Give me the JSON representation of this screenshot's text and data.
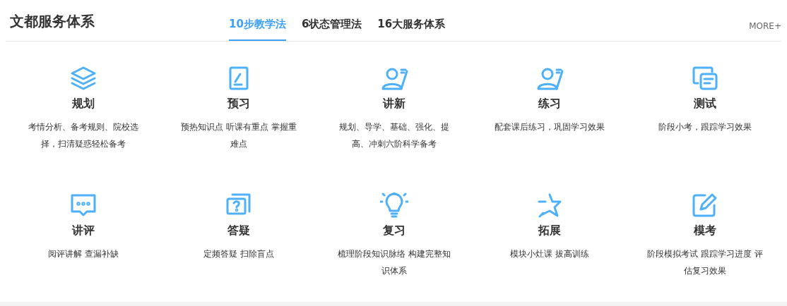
{
  "header": {
    "title": "文都服务体系",
    "more": "MORE+"
  },
  "tabs": [
    {
      "label": "10步教学法",
      "selected": true
    },
    {
      "label": "6状态管理法",
      "selected": false
    },
    {
      "label": "16大服务体系",
      "selected": false
    }
  ],
  "steps": [
    {
      "title": "规划",
      "description": "考情分析、备考规则、院校选择，扫清疑惑轻松备考"
    },
    {
      "title": "预习",
      "description": "预热知识点 听课有重点 掌握重难点"
    },
    {
      "title": "讲新",
      "description": "规划、导学、基础、强化、提高、冲刺六阶科学备考"
    },
    {
      "title": "练习",
      "description": "配套课后练习，巩固学习效果"
    },
    {
      "title": "测试",
      "description": "阶段小考，跟踪学习效果"
    },
    {
      "title": "讲评",
      "description": "阅评讲解 查漏补缺"
    },
    {
      "title": "答疑",
      "description": "定频答疑 扫除盲点"
    },
    {
      "title": "复习",
      "description": "梳理阶段知识脉络 构建完整知识体系"
    },
    {
      "title": "拓展",
      "description": "模块小灶课 拔高训练"
    },
    {
      "title": "模考",
      "description": "阶段模拟考试 跟踪学习进度 评估复习效果"
    }
  ]
}
